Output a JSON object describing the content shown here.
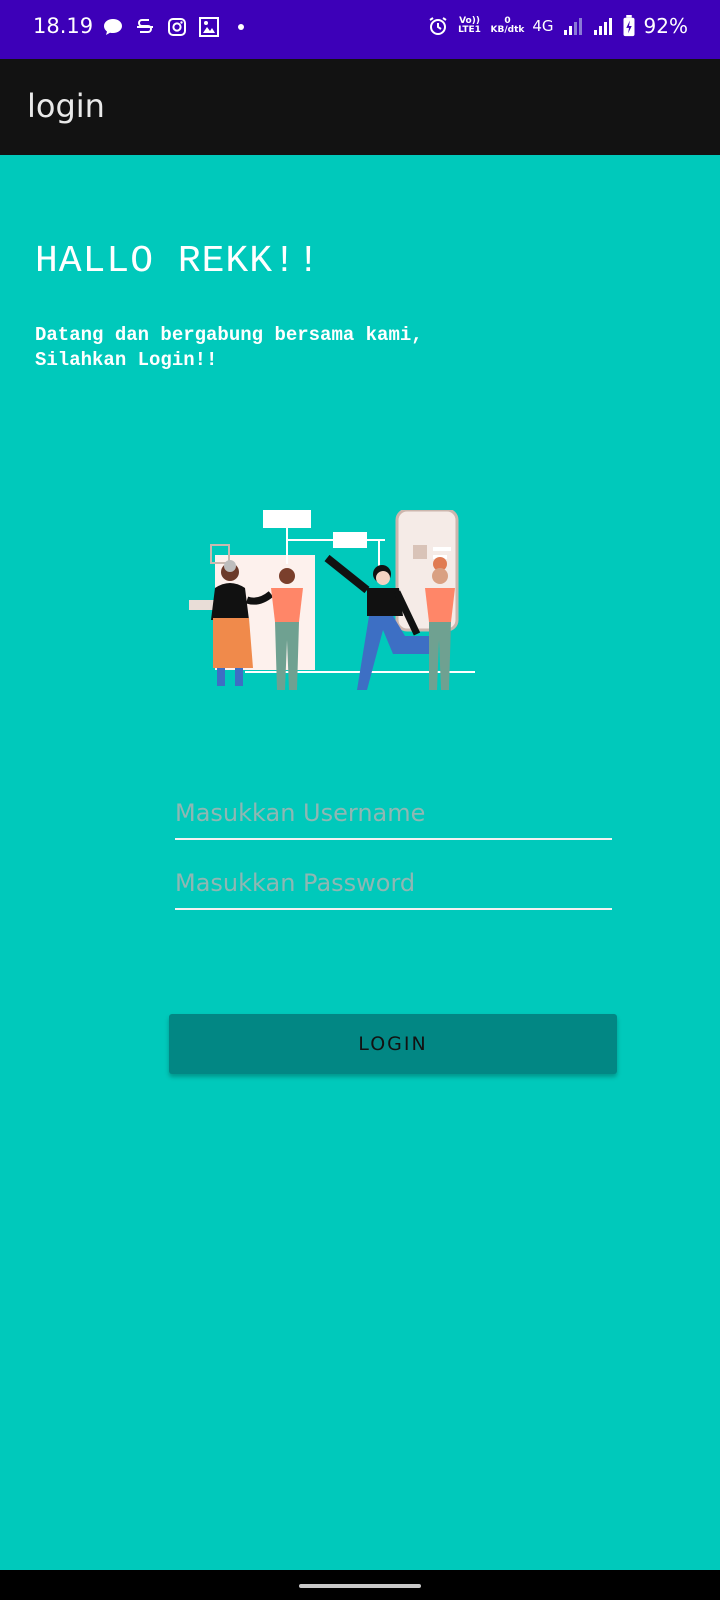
{
  "status_bar": {
    "time": "18.19",
    "left_icons": [
      "chat-bubble-icon",
      "s-app-icon",
      "instagram-icon",
      "gallery-icon",
      "dot-icon"
    ],
    "volte_label": "Vo)) LTE1",
    "net_speed_value": "0",
    "net_speed_unit": "KB/dtk",
    "network_type": "4G",
    "battery_percent": "92%"
  },
  "app_bar": {
    "title": "login"
  },
  "main": {
    "headline": "HALLO REKK!!",
    "subtitle": "Datang dan bergabung bersama kami,\nSilahkan Login!!",
    "username_placeholder": "Masukkan Username",
    "password_placeholder": "Masukkan Password",
    "login_button": "LOGIN"
  },
  "colors": {
    "background": "#00C9BB",
    "status_bar": "#3D00B8",
    "app_bar": "#121212",
    "button": "#028784"
  }
}
